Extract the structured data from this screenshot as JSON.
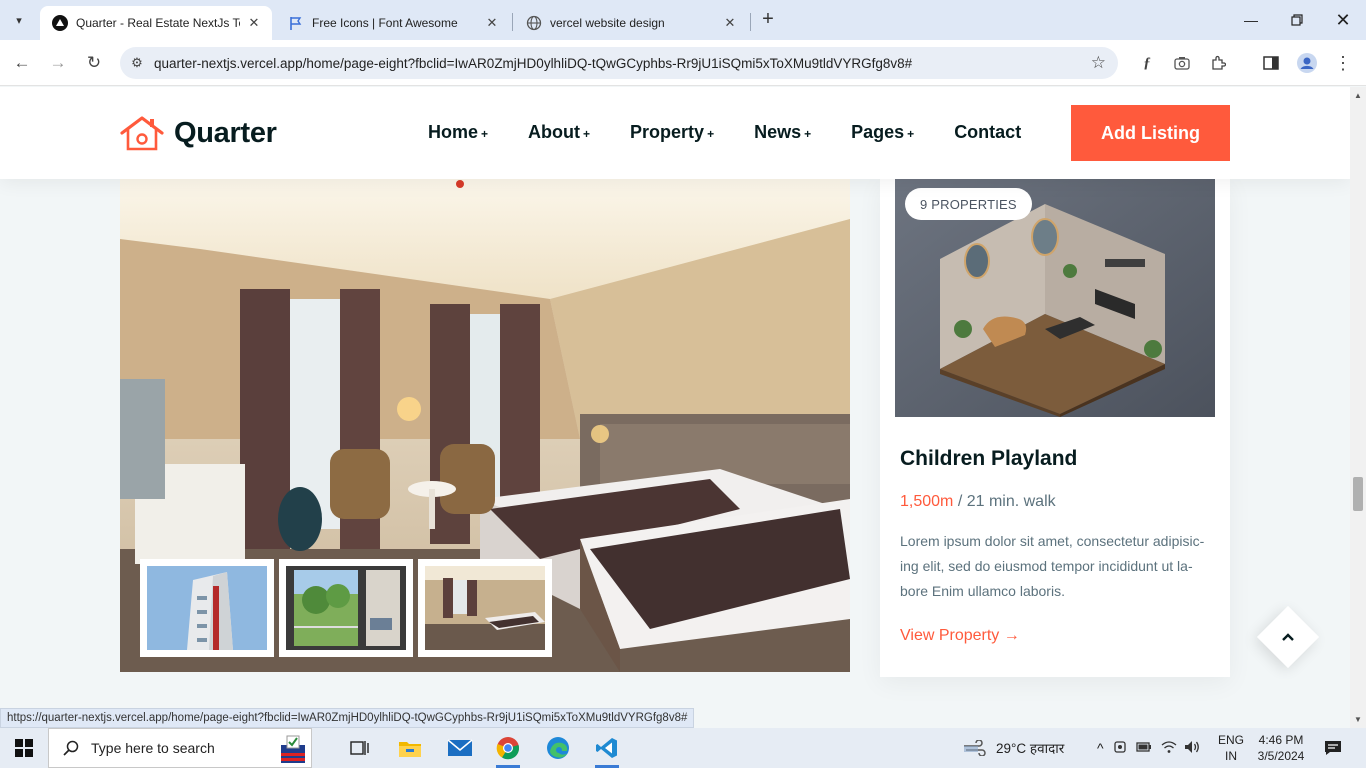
{
  "browser": {
    "tabs": [
      {
        "title": "Quarter - Real Estate NextJs Ten",
        "active": true
      },
      {
        "title": "Free Icons | Font Awesome",
        "active": false
      },
      {
        "title": "vercel website design",
        "active": false
      }
    ],
    "url": "quarter-nextjs.vercel.app/home/page-eight?fbclid=IwAR0ZmjHD0ylhliDQ-tQwGCyphbs-Rr9jU1iSQmi5xToXMu9tldVYRGfg8v8#",
    "status_url": "https://quarter-nextjs.vercel.app/home/page-eight?fbclid=IwAR0ZmjHD0ylhliDQ-tQwGCyphbs-Rr9jU1iSQmi5xToXMu9tldVYRGfg8v8#"
  },
  "site": {
    "logo_text": "Quarter",
    "nav": [
      {
        "label": "Home",
        "plus": "+"
      },
      {
        "label": "About",
        "plus": "+"
      },
      {
        "label": "Property",
        "plus": "+"
      },
      {
        "label": "News",
        "plus": "+"
      },
      {
        "label": "Pages",
        "plus": "+"
      },
      {
        "label": "Contact",
        "plus": ""
      }
    ],
    "cta": "Add Listing",
    "accent_color": "#ff5a3c"
  },
  "card": {
    "badge": "9 PROPERTIES",
    "title": "Children Playland",
    "distance": "1,500m",
    "walk": " / 21 min. walk",
    "description": "Lorem ipsum dolor sit amet, consectetur adipisic-ing elit, sed do eiusmod tempor incididunt ut la-bore Enim ullamco laboris.",
    "link": "View Property",
    "link_arrow": "→"
  },
  "taskbar": {
    "search_placeholder": "Type here to search",
    "weather": "29°C  हवादार",
    "lang_top": "ENG",
    "lang_bottom": "IN",
    "time": "4:46 PM",
    "date": "3/5/2024"
  }
}
